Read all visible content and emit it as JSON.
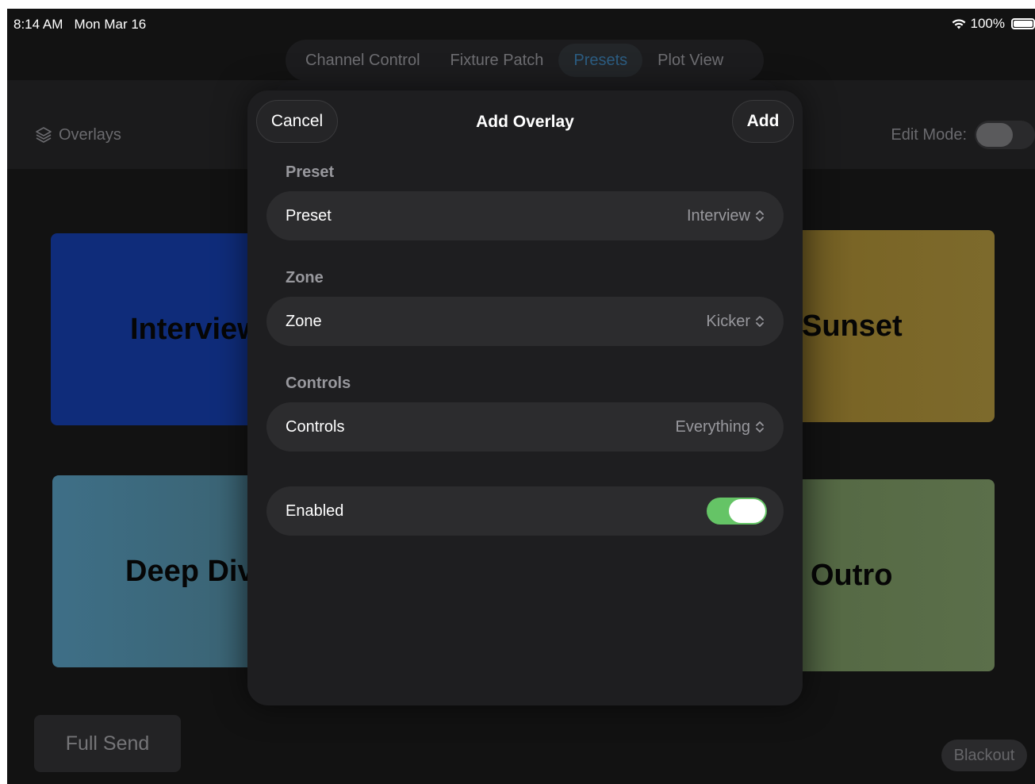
{
  "status_bar": {
    "time": "8:14 AM",
    "date": "Mon Mar 16",
    "battery": "100%"
  },
  "tabs": [
    {
      "label": "Channel Control",
      "active": false
    },
    {
      "label": "Fixture Patch",
      "active": false
    },
    {
      "label": "Presets",
      "active": true
    },
    {
      "label": "Plot View",
      "active": false
    }
  ],
  "header": {
    "overlays_label": "Overlays",
    "edit_mode_label": "Edit Mode:",
    "edit_mode_on": false
  },
  "tiles": {
    "interview": "Interview",
    "sunset": "Sunset",
    "deep_dive": "Deep Dive",
    "outro": "Outro"
  },
  "bottom": {
    "full_send": "Full Send",
    "blackout": "Blackout"
  },
  "sheet": {
    "title": "Add Overlay",
    "cancel": "Cancel",
    "add": "Add",
    "sections": {
      "preset": {
        "header": "Preset",
        "label": "Preset",
        "value": "Interview"
      },
      "zone": {
        "header": "Zone",
        "label": "Zone",
        "value": "Kicker"
      },
      "controls": {
        "header": "Controls",
        "label": "Controls",
        "value": "Everything"
      }
    },
    "enabled": {
      "label": "Enabled",
      "on": true
    }
  },
  "colors": {
    "accent_tab": "#2c5d82",
    "toggle_on": "#65c466",
    "sheet_bg": "#1e1e20",
    "row_bg": "#2c2c2e"
  },
  "icons": [
    "wifi-icon",
    "battery-icon",
    "layers-icon",
    "chevron-up-down-icon"
  ]
}
